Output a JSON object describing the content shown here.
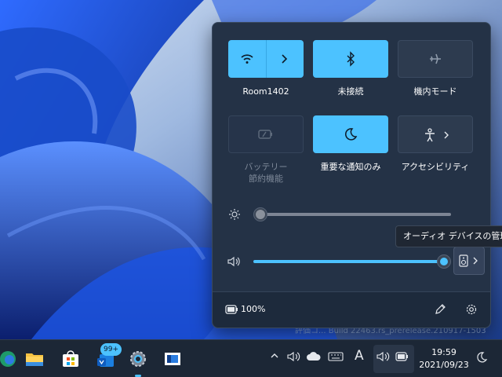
{
  "quick_settings": {
    "tiles": [
      {
        "label": "Room1402",
        "icon": "wifi-icon",
        "state": "on",
        "has_arrow": true
      },
      {
        "label": "未接続",
        "icon": "bluetooth-icon",
        "state": "on",
        "has_arrow": false
      },
      {
        "label": "機内モード",
        "icon": "airplane-icon",
        "state": "off",
        "has_arrow": false
      },
      {
        "label_line1": "バッテリー",
        "label_line2": "節約機能",
        "icon": "battery-saver-icon",
        "state": "disabled",
        "has_arrow": false
      },
      {
        "label": "重要な通知のみ",
        "icon": "moon-icon",
        "state": "on",
        "has_arrow": false
      },
      {
        "label": "アクセシビリティ",
        "icon": "accessibility-icon",
        "state": "off",
        "has_arrow": true
      }
    ],
    "brightness": {
      "icon": "brightness-icon",
      "level": 0.0
    },
    "volume": {
      "icon": "speaker-icon",
      "level": 1.0
    },
    "audio_tooltip": "オーディオ デバイスの管理",
    "battery": {
      "icon": "battery-icon",
      "percent_text": "100%"
    },
    "edit_icon": "pencil-icon",
    "settings_icon": "gear-icon"
  },
  "watermark_text": "評価コ... Build 22463.rs_prerelease.210917-1503",
  "taskbar": {
    "apps": [
      "edge-icon",
      "file-explorer-icon",
      "store-icon",
      "mail-icon",
      "settings-app-icon",
      "app-window-icon"
    ],
    "mail_badge": "99+",
    "tray": [
      "chevron-up-icon",
      "speaker-icon",
      "cloud-icon",
      "keyboard-icon",
      "ime-icon",
      "speaker-icon",
      "battery-icon"
    ],
    "ime_text": "A",
    "clock_time": "19:59",
    "clock_date": "2021/09/23"
  },
  "colors": {
    "accent": "#4cc2ff",
    "panel": "#243246",
    "taskbar": "#1c2736"
  }
}
